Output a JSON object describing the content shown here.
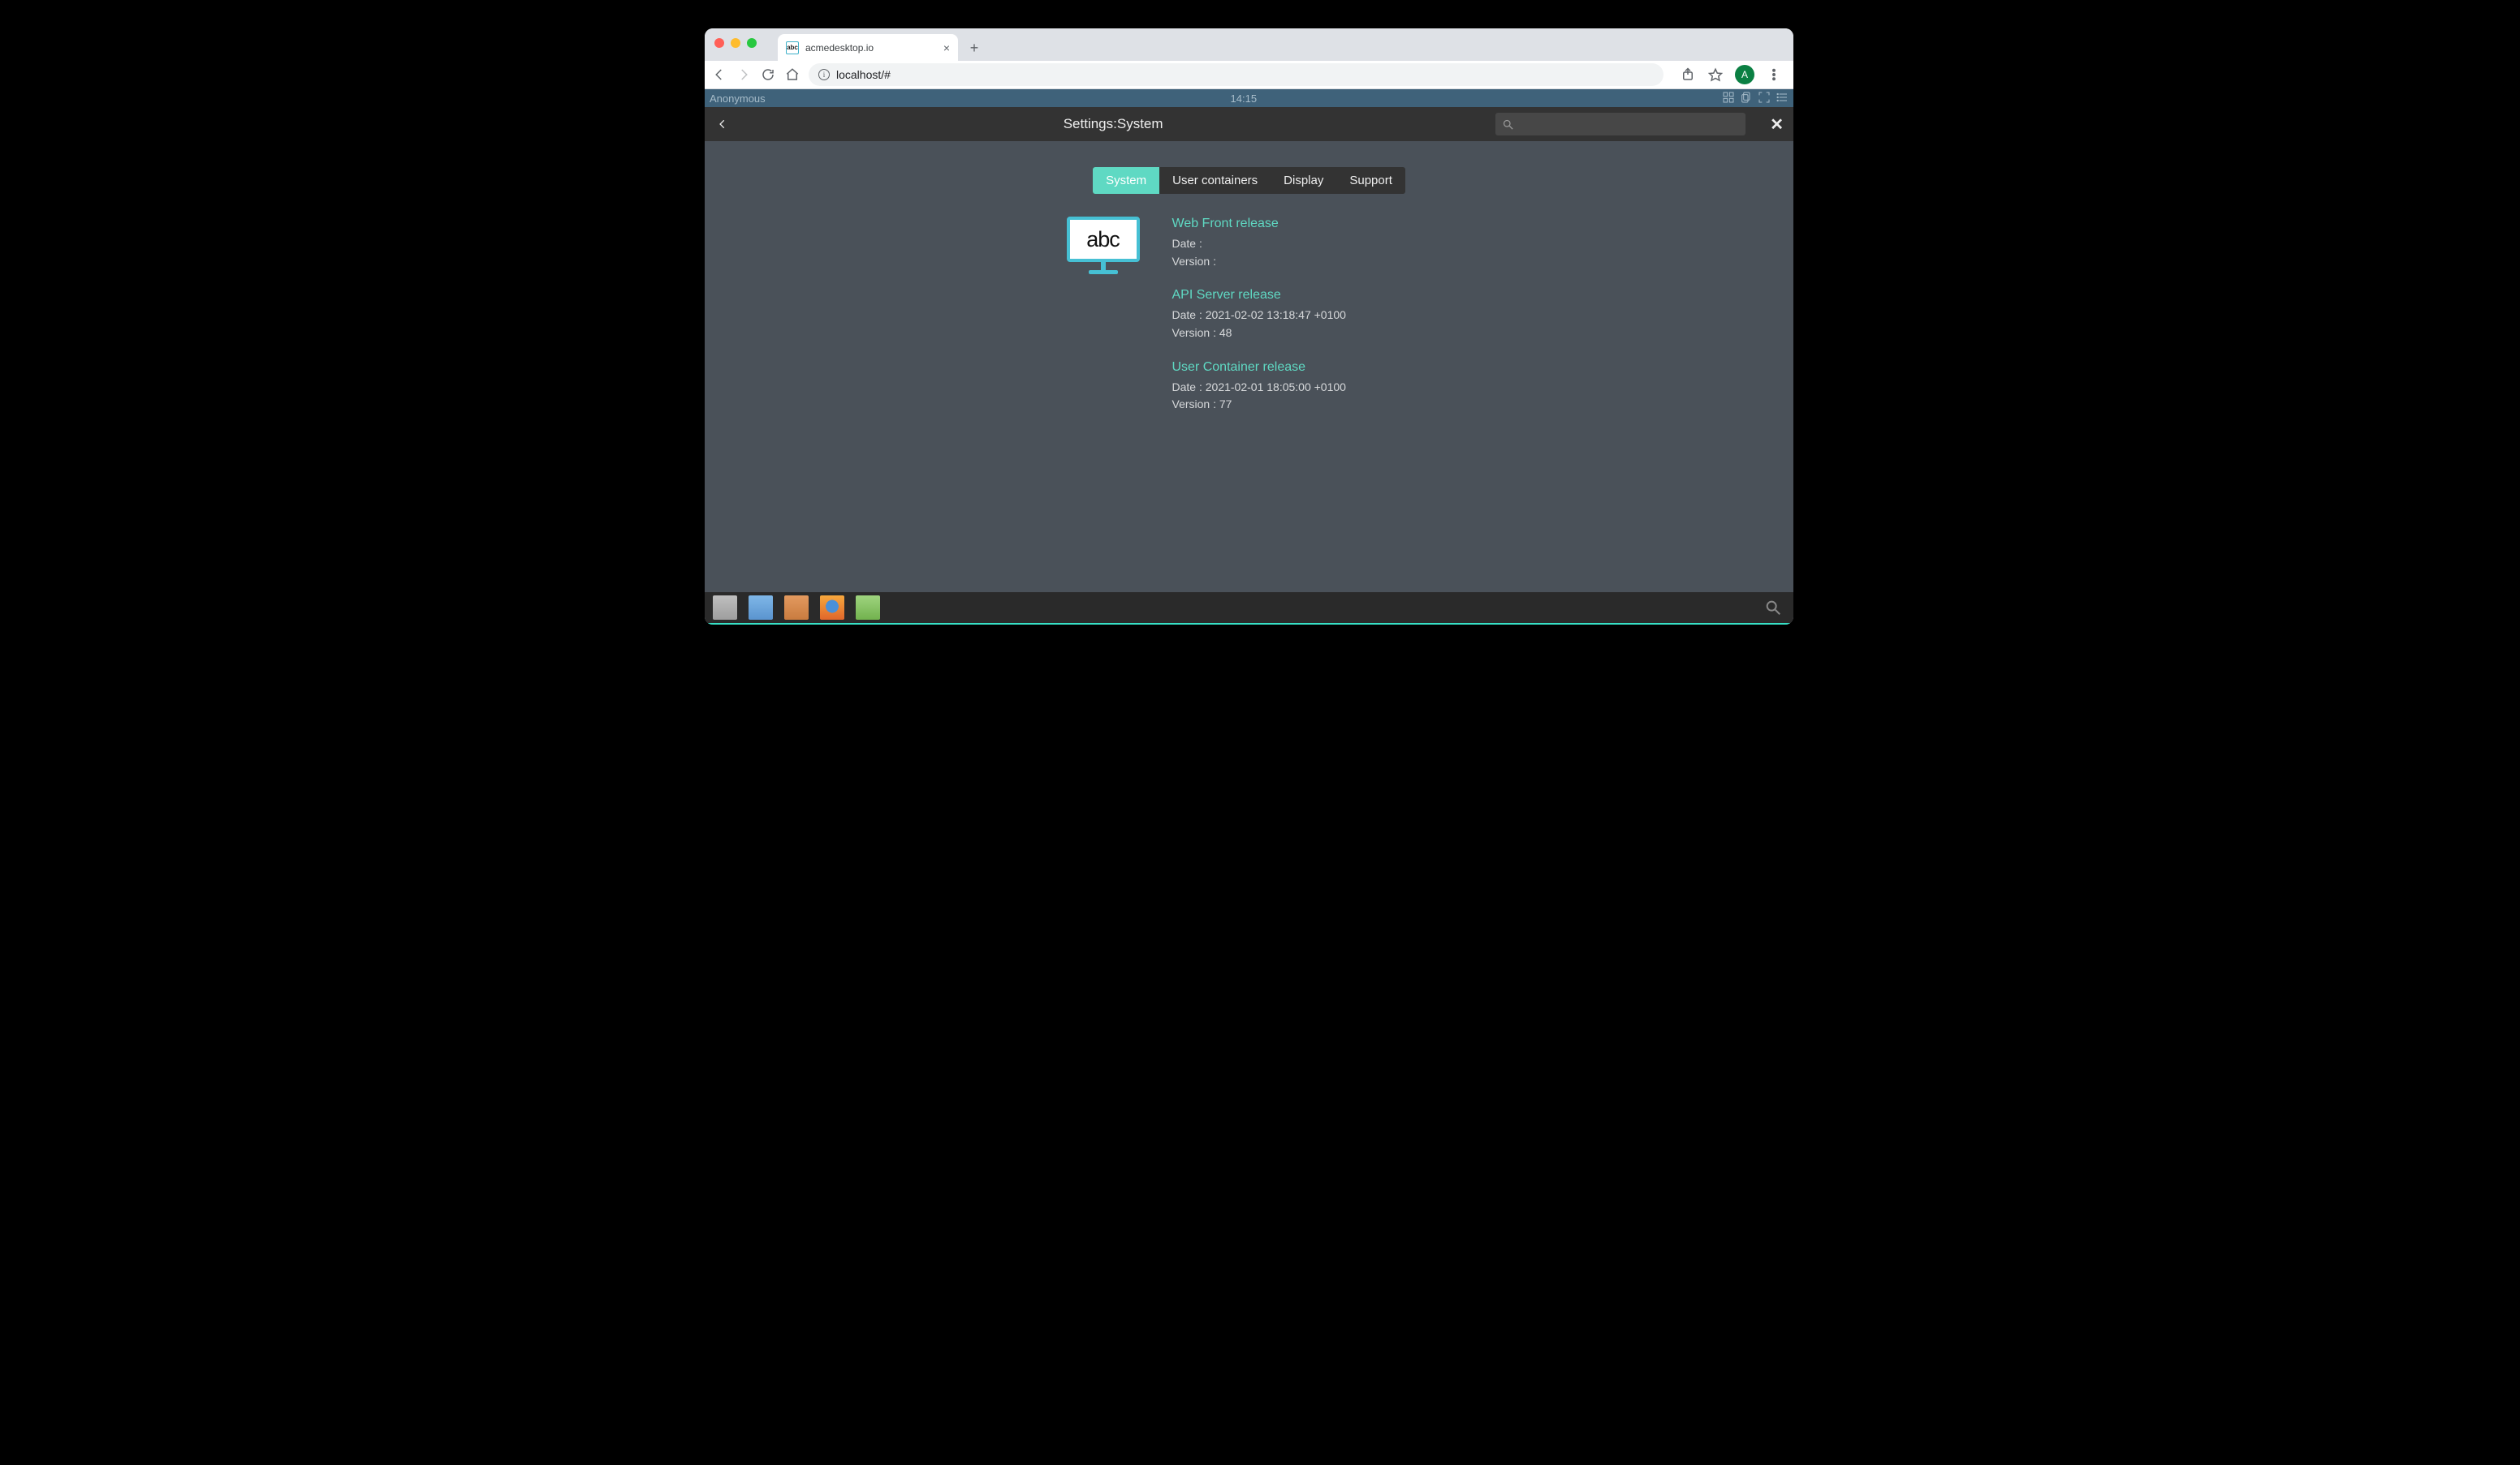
{
  "browser": {
    "tab_title": "acmedesktop.io",
    "favicon_text": "abc",
    "url": "localhost/#",
    "avatar_letter": "A"
  },
  "topbar": {
    "user": "Anonymous",
    "time": "14:15"
  },
  "header": {
    "title": "Settings:System"
  },
  "tabs": [
    {
      "label": "System",
      "active": true
    },
    {
      "label": "User containers",
      "active": false
    },
    {
      "label": "Display",
      "active": false
    },
    {
      "label": "Support",
      "active": false
    }
  ],
  "logo_text": "abc",
  "releases": [
    {
      "title": "Web Front release",
      "date_label": "Date :",
      "date_value": "",
      "version_label": "Version :",
      "version_value": ""
    },
    {
      "title": "API Server release",
      "date_label": "Date :",
      "date_value": "2021-02-02 13:18:47 +0100",
      "version_label": "Version :",
      "version_value": "48"
    },
    {
      "title": "User Container release",
      "date_label": "Date :",
      "date_value": "2021-02-01 18:05:00 +0100",
      "version_label": "Version :",
      "version_value": "77"
    }
  ]
}
